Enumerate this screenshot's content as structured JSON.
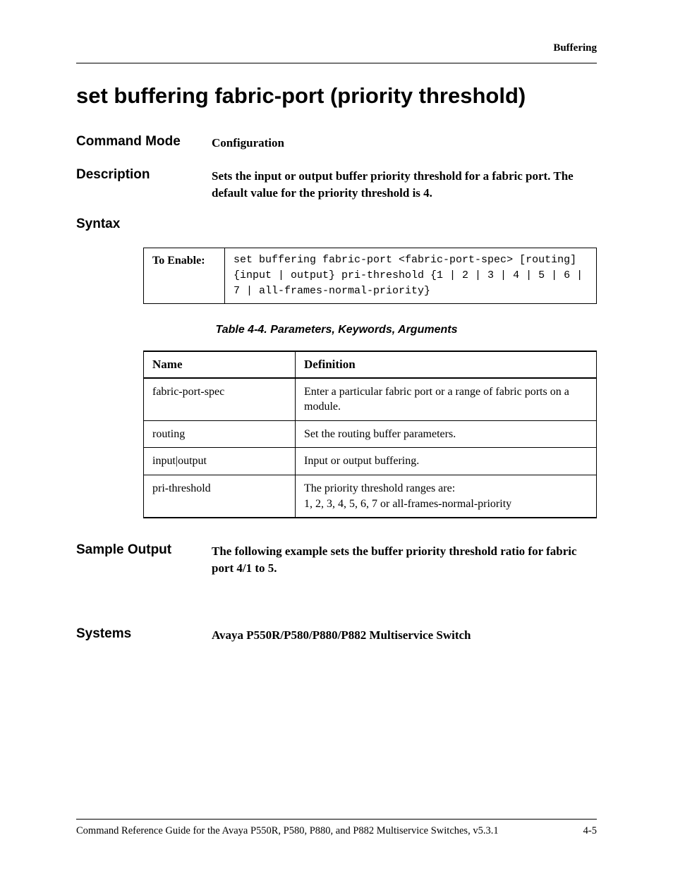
{
  "header": {
    "section_label": "Buffering"
  },
  "title": "set buffering fabric-port (priority threshold)",
  "sections": {
    "command_mode": {
      "label": "Command Mode",
      "value": "Configuration"
    },
    "description": {
      "label": "Description",
      "value": "Sets the input or output buffer priority threshold for a fabric port. The default value for the priority threshold is 4."
    },
    "syntax": {
      "label": "Syntax",
      "to_enable_label": "To Enable:",
      "code": "set buffering fabric-port <fabric-port-spec> [routing] {input | output} pri-threshold {1 | 2 | 3 | 4 | 5 | 6 | 7 | all-frames-normal-priority}"
    },
    "params_table": {
      "caption": "Table 4-4.  Parameters, Keywords, Arguments",
      "headers": {
        "name": "Name",
        "definition": "Definition"
      },
      "rows": [
        {
          "name": "fabric-port-spec",
          "definition": "Enter a particular fabric port or a range of fabric ports on a module."
        },
        {
          "name": "routing",
          "definition": "Set the routing buffer parameters."
        },
        {
          "name": "input|output",
          "definition": "Input or output buffering."
        },
        {
          "name": "pri-threshold",
          "definition": "The priority threshold ranges are:\n1, 2, 3, 4, 5, 6, 7 or all-frames-normal-priority"
        }
      ]
    },
    "sample_output": {
      "label": "Sample Output",
      "value": "The following example sets the buffer priority threshold ratio for fabric port 4/1 to 5."
    },
    "systems": {
      "label": "Systems",
      "value": "Avaya P550R/P580/P880/P882 Multiservice Switch"
    }
  },
  "footer": {
    "guide": "Command Reference Guide for the Avaya P550R, P580, P880, and P882 Multiservice Switches, v5.3.1",
    "page": "4-5"
  }
}
